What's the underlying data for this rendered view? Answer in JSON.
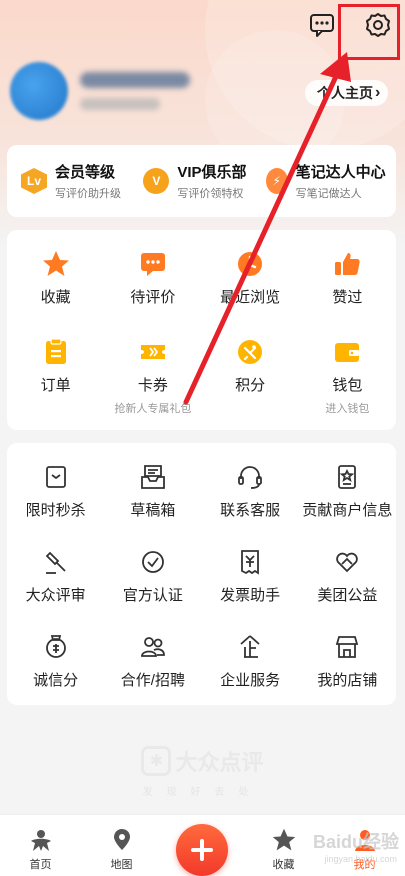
{
  "header": {
    "homepage_label": "个人主页",
    "homepage_chevron": "›"
  },
  "levels": [
    {
      "title": "会员等级",
      "subtitle": "写评价助升级",
      "badge": "Lv",
      "color": "#f5a623"
    },
    {
      "title": "VIP俱乐部",
      "subtitle": "写评价领特权",
      "badge": "V",
      "color": "#f7a21b"
    },
    {
      "title": "笔记达人中心",
      "subtitle": "写笔记做达人",
      "badge": "⚡",
      "color": "#ff8a3d"
    }
  ],
  "shortcuts": [
    {
      "label": "收藏",
      "icon": "star-icon"
    },
    {
      "label": "待评价",
      "icon": "comment-icon"
    },
    {
      "label": "最近浏览",
      "icon": "clock-icon"
    },
    {
      "label": "赞过",
      "icon": "thumbs-up-icon"
    },
    {
      "label": "订单",
      "icon": "order-icon"
    },
    {
      "label": "卡券",
      "icon": "ticket-icon",
      "subtitle": "抢新人专属礼包"
    },
    {
      "label": "积分",
      "icon": "points-icon"
    },
    {
      "label": "钱包",
      "icon": "wallet-icon",
      "subtitle": "进入钱包"
    }
  ],
  "services": [
    {
      "label": "限时秒杀",
      "icon": "flash-sale-icon"
    },
    {
      "label": "草稿箱",
      "icon": "drafts-icon"
    },
    {
      "label": "联系客服",
      "icon": "headset-icon"
    },
    {
      "label": "贡献商户信息",
      "icon": "contribute-icon"
    },
    {
      "label": "大众评审",
      "icon": "gavel-icon"
    },
    {
      "label": "官方认证",
      "icon": "verified-icon"
    },
    {
      "label": "发票助手",
      "icon": "invoice-icon"
    },
    {
      "label": "美团公益",
      "icon": "charity-icon"
    },
    {
      "label": "诚信分",
      "icon": "credit-icon"
    },
    {
      "label": "合作/招聘",
      "icon": "people-icon"
    },
    {
      "label": "企业服务",
      "icon": "enterprise-icon"
    },
    {
      "label": "我的店铺",
      "icon": "shop-icon"
    }
  ],
  "watermark": {
    "brand": "大众点评",
    "slogan": "发现好去处"
  },
  "tabbar": [
    {
      "label": "首页",
      "icon": "home-icon"
    },
    {
      "label": "地图",
      "icon": "map-icon"
    },
    {
      "label": "",
      "icon": "plus-icon"
    },
    {
      "label": "收藏",
      "icon": "star-icon"
    },
    {
      "label": "我的",
      "icon": "me-icon",
      "active": true
    }
  ],
  "colors": {
    "accent": "#ff5a1f",
    "annotation": "#e6212a",
    "icon_orange": "#ff7a21",
    "icon_yellow": "#ffb400"
  },
  "overlay_watermark": {
    "text": "Baidu经验",
    "sub": "jingyan.baidu.com"
  }
}
